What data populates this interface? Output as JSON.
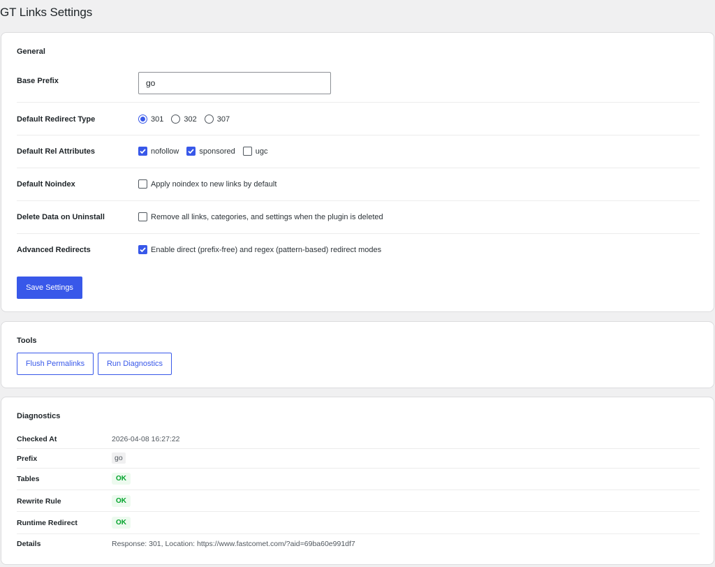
{
  "page": {
    "title": "GT Links Settings"
  },
  "general": {
    "heading": "General",
    "base_prefix": {
      "label": "Base Prefix",
      "value": "go"
    },
    "redirect_type": {
      "label": "Default Redirect Type",
      "options": [
        "301",
        "302",
        "307"
      ],
      "selected": "301"
    },
    "rel_attributes": {
      "label": "Default Rel Attributes",
      "options": [
        {
          "label": "nofollow",
          "checked": true
        },
        {
          "label": "sponsored",
          "checked": true
        },
        {
          "label": "ugc",
          "checked": false
        }
      ]
    },
    "noindex": {
      "label": "Default Noindex",
      "option": "Apply noindex to new links by default",
      "checked": false
    },
    "delete_data": {
      "label": "Delete Data on Uninstall",
      "option": "Remove all links, categories, and settings when the plugin is deleted",
      "checked": false
    },
    "advanced": {
      "label": "Advanced Redirects",
      "option": "Enable direct (prefix-free) and regex (pattern-based) redirect modes",
      "checked": true
    },
    "save_label": "Save Settings"
  },
  "tools": {
    "heading": "Tools",
    "flush_label": "Flush Permalinks",
    "diagnostics_label": "Run Diagnostics"
  },
  "diagnostics": {
    "heading": "Diagnostics",
    "checked_at": {
      "label": "Checked At",
      "value": "2026-04-08 16:27:22"
    },
    "prefix": {
      "label": "Prefix",
      "value": "go"
    },
    "tables": {
      "label": "Tables",
      "value": "OK"
    },
    "rewrite_rule": {
      "label": "Rewrite Rule",
      "value": "OK"
    },
    "runtime_redirect": {
      "label": "Runtime Redirect",
      "value": "OK"
    },
    "details": {
      "label": "Details",
      "value": "Response: 301, Location: https://www.fastcomet.com/?aid=69ba60e991df7"
    }
  },
  "colors": {
    "accent": "#3858e9",
    "ok_text": "#00a32a",
    "ok_bg": "#edfaef"
  }
}
